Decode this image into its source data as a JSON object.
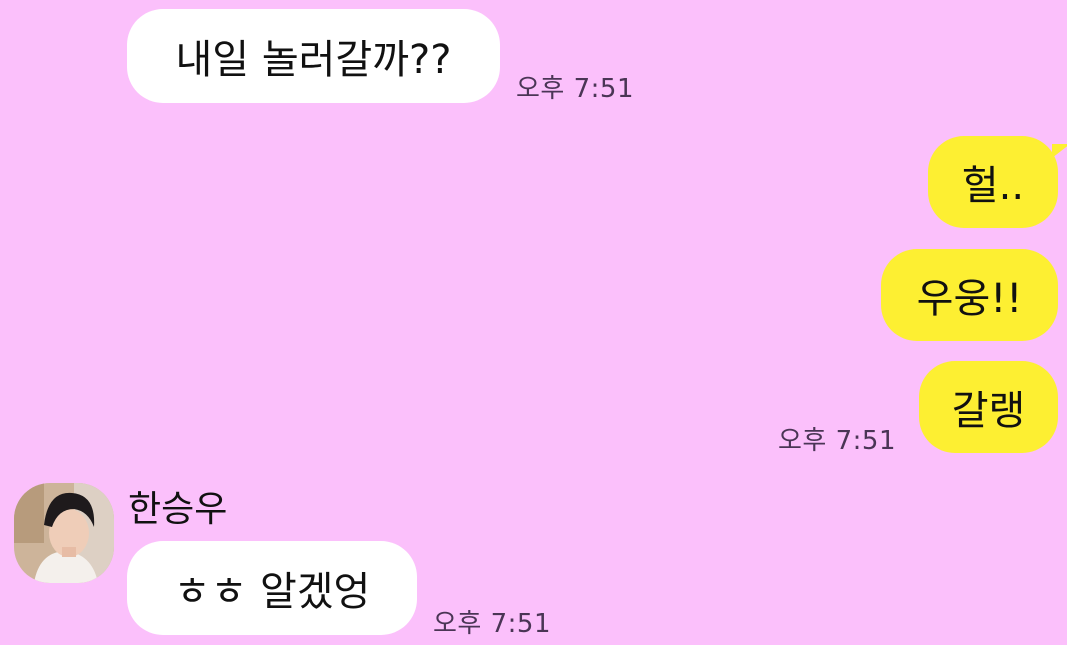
{
  "conversation": {
    "messages": [
      {
        "direction": "incoming",
        "text": "내일 놀러갈까??",
        "time": "오후 7:51"
      },
      {
        "direction": "outgoing",
        "text": "헐..",
        "time": ""
      },
      {
        "direction": "outgoing",
        "text": "우웅!!",
        "time": ""
      },
      {
        "direction": "outgoing",
        "text": "갈랭",
        "time": "오후 7:51"
      },
      {
        "direction": "incoming",
        "sender": "한승우",
        "text": "ㅎㅎ 알겠엉",
        "time": "오후 7:51"
      }
    ]
  },
  "colors": {
    "background": "#fbc0fb",
    "incoming_bubble": "#ffffff",
    "outgoing_bubble": "#fdef32",
    "timestamp": "#4a3555"
  },
  "icons": {
    "avatar": "profile-photo"
  }
}
